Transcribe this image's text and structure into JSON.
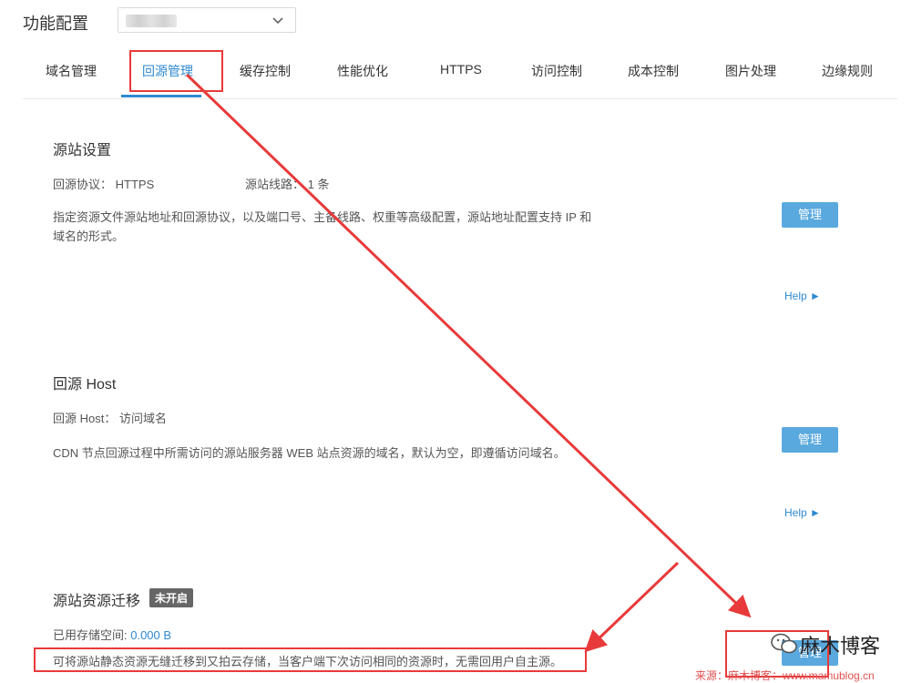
{
  "header": {
    "title": "功能配置",
    "domain_select": {
      "value": "",
      "icon": "chevron-down-icon"
    }
  },
  "tabs": [
    {
      "label": "域名管理"
    },
    {
      "label": "回源管理",
      "active": true
    },
    {
      "label": "缓存控制"
    },
    {
      "label": "性能优化"
    },
    {
      "label": "HTTPS"
    },
    {
      "label": "访问控制"
    },
    {
      "label": "成本控制"
    },
    {
      "label": "图片处理"
    },
    {
      "label": "边缘规则"
    }
  ],
  "origin_settings": {
    "title": "源站设置",
    "protocol_label": "回源协议：",
    "protocol_value": "HTTPS",
    "lines_label": "源站线路：",
    "lines_value": "1 条",
    "description_line1": "指定资源文件源站地址和回源协议，以及端口号、主备线路、权重等高级配置，源站地址配置支持 IP 和",
    "description_line2": "域名的形式。",
    "manage_label": "管理",
    "help_label": "Help ►"
  },
  "origin_host": {
    "title": "回源 Host",
    "host_label": "回源 Host：",
    "host_value": "访问域名",
    "description": "CDN 节点回源过程中所需访问的源站服务器 WEB 站点资源的域名，默认为空，即遵循访问域名。",
    "manage_label": "管理",
    "help_label": "Help ►"
  },
  "migration": {
    "title": "源站资源迁移",
    "status_badge": "未开启",
    "storage_label": "已用存储空间: ",
    "storage_value": "0.000 B",
    "description": "可将源站静态资源无缝迁移到又拍云存储，当客户端下次访问相同的资源时，无需回用户自主源。",
    "manage_label": "管理"
  },
  "watermark": {
    "name": "麻木博客",
    "source": "来源：麻木博客：www.mamublog.cn"
  },
  "colors": {
    "accent": "#2f8ad0",
    "button": "#5aa9de",
    "annotation": "#e83a3a"
  }
}
